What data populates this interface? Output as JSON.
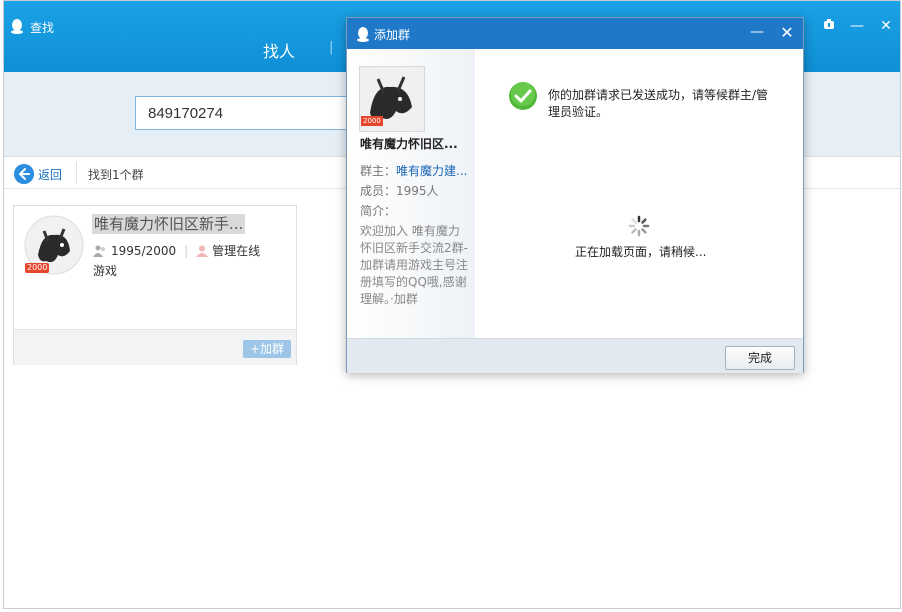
{
  "window": {
    "title": "查找",
    "nav_tab_active": "找人",
    "nav_separator": "|",
    "controls": {
      "pin_icon": "pin-icon",
      "minimize": "—",
      "close": "✕"
    }
  },
  "search": {
    "value": "849170274"
  },
  "results": {
    "back_label": "返回",
    "count_text": "找到1个群"
  },
  "card": {
    "name": "唯有魔力怀旧区新手...",
    "members": "1995/2000",
    "manager_status": "管理在线",
    "tag": "游戏",
    "badge": "2000",
    "join_label": "+加群"
  },
  "dialog": {
    "title": "添加群",
    "group_name": "唯有魔力怀旧区...",
    "badge": "2000",
    "owner_label": "群主：",
    "owner_value": "唯有魔力建...",
    "members_label": "成员：",
    "members_value": "1995人",
    "intro_label": "简介：",
    "intro_text": "欢迎加入 唯有魔力怀旧区新手交流2群-加群请用游戏主号注册填写的QQ哦,感谢理解。·加群",
    "success_message": "你的加群请求已发送成功，请等候群主/管理员验证。",
    "loading_message": "正在加载页面，请稍候...",
    "done_label": "完成"
  },
  "colors": {
    "titlebar": "#1296db",
    "dialog_title": "#1f78c8",
    "link": "#1a66b5",
    "success": "#52b83a",
    "badge": "#e5462c"
  }
}
